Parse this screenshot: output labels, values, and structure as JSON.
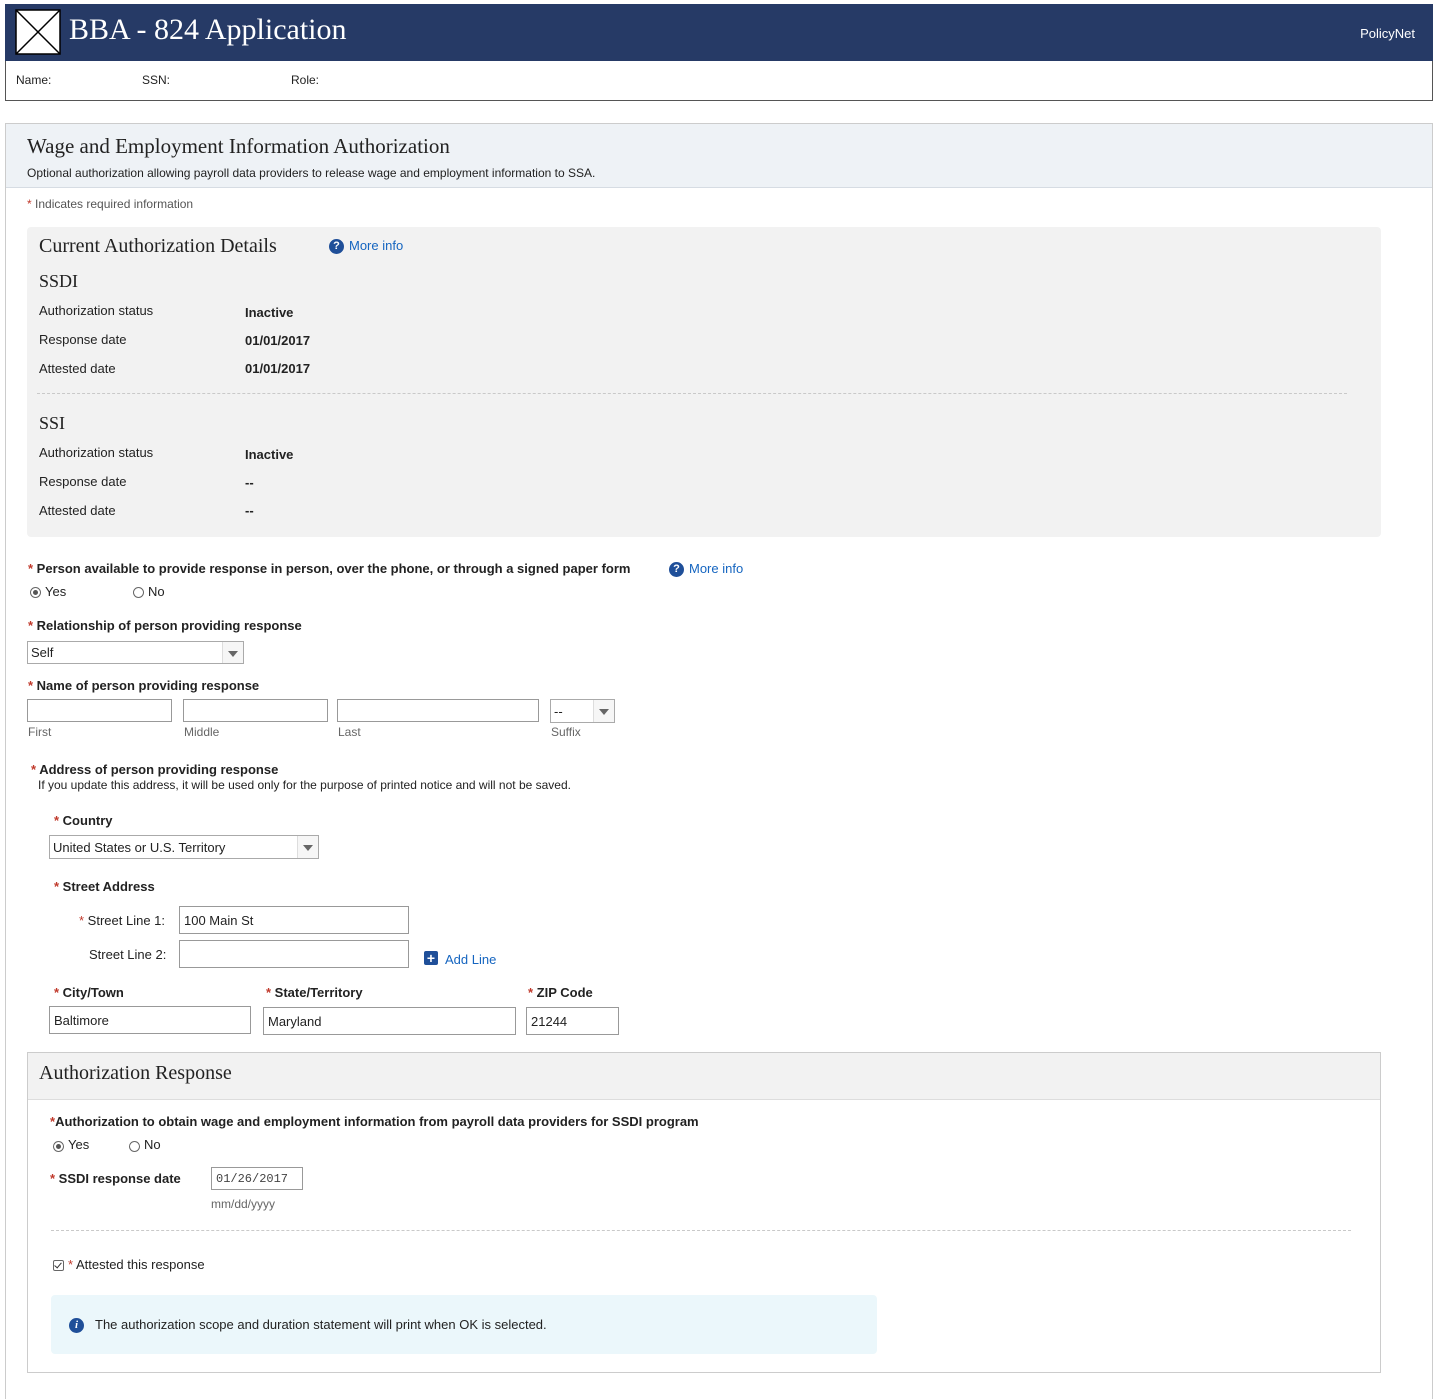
{
  "header": {
    "app_title": "BBA - 824 Application",
    "right_link": "PolicyNet"
  },
  "user_bar": {
    "name_label": "Name:",
    "ssn_label": "SSN:",
    "role_label": "Role:"
  },
  "page": {
    "title": "Wage and Employment Information Authorization",
    "subtitle": "Optional authorization allowing payroll data providers to release wage and employment information to SSA.",
    "required_note": "Indicates required information"
  },
  "current_details": {
    "title": "Current Authorization Details",
    "more_info": "More info",
    "ssdi": {
      "heading": "SSDI",
      "rows": [
        {
          "label": "Authorization status",
          "value": "Inactive"
        },
        {
          "label": "Response date",
          "value": "01/01/2017"
        },
        {
          "label": "Attested date",
          "value": "01/01/2017"
        }
      ]
    },
    "ssi": {
      "heading": "SSI",
      "rows": [
        {
          "label": "Authorization status",
          "value": "Inactive"
        },
        {
          "label": "Response date",
          "value": "--"
        },
        {
          "label": "Attested date",
          "value": "--"
        }
      ]
    }
  },
  "person_available": {
    "label": "Person available to provide response in person, over the phone, or through a signed paper form",
    "more_info": "More info",
    "yes": "Yes",
    "no": "No",
    "selected": "Yes"
  },
  "relationship": {
    "label": "Relationship of person providing response",
    "value": "Self"
  },
  "name_fields": {
    "label": "Name of person providing response",
    "first": "",
    "middle": "",
    "last": "",
    "suffix": "--",
    "first_hint": "First",
    "middle_hint": "Middle",
    "last_hint": "Last",
    "suffix_hint": "Suffix"
  },
  "address": {
    "label": "Address of person providing response",
    "note": "If you update this address, it will be used only for the purpose of printed notice and will not be saved.",
    "country_label": "Country",
    "country_value": "United States or U.S. Territory",
    "street_label": "Street Address",
    "street1_label": "Street Line 1:",
    "street1_value": "100 Main St",
    "street2_label": "Street Line 2:",
    "street2_value": "",
    "add_line": "Add Line",
    "city_label": "City/Town",
    "city_value": "Baltimore",
    "state_label": "State/Territory",
    "state_value": "Maryland",
    "zip_label": "ZIP Code",
    "zip_value": "21244"
  },
  "auth_response": {
    "title": "Authorization Response",
    "question": "Authorization to obtain wage and employment information from payroll data providers for SSDI program",
    "yes": "Yes",
    "no": "No",
    "selected": "Yes",
    "date_label": "SSDI response date",
    "date_value": "01/26/2017",
    "date_hint": "mm/dd/yyyy",
    "attested_label": "Attested this response",
    "attested": true,
    "info_text": "The authorization scope and duration statement will print when OK is selected."
  },
  "colors": {
    "header_bg": "#263a66",
    "link": "#1565c0",
    "required": "#c0392b",
    "info_bg": "#ebf7fb"
  }
}
